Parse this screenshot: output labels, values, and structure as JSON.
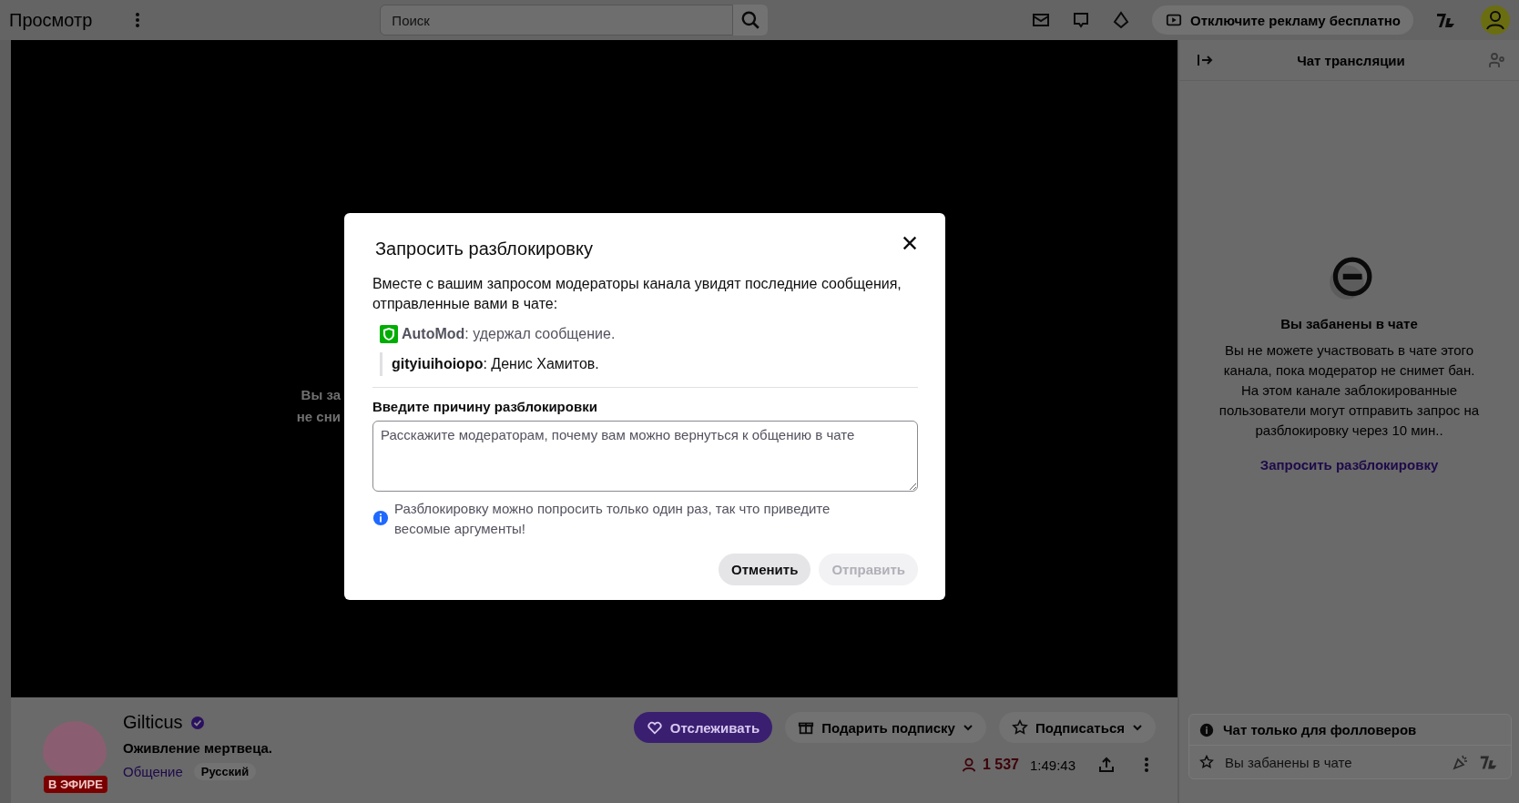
{
  "top_bar": {
    "title": "Просмотр",
    "search": {
      "placeholder": "Поиск"
    },
    "ad_button": "Отключите рекламу бесплатно"
  },
  "video": {
    "lines": [
      "Вы за",
      "не сни"
    ]
  },
  "channel": {
    "name": "Gilticus",
    "verified": true,
    "live_badge": "В ЭФИРЕ",
    "stream_title": "Оживление мертвеца.",
    "category": "Общение",
    "tags": [
      "Русский"
    ],
    "buttons": [
      {
        "label": "Отслеживать",
        "kind": "follow"
      },
      {
        "label": "Подарить подписку",
        "kind": "gift"
      },
      {
        "label": "Подписаться",
        "kind": "subscribe"
      }
    ],
    "viewers": "1 537",
    "uptime": "1:49:43"
  },
  "chat": {
    "title": "Чат трансляции",
    "banned_title": "Вы забанены в чате",
    "banned_text": "Вы не можете участвовать в чате этого канала, пока модератор не снимет бан. На этом канале заблокированные пользователи могут отправить запрос на разблокировку через 10 мин..",
    "request_link": "Запросить разблокировку",
    "notice": "Чат только для фолловеров",
    "input_placeholder": "Вы забанены в чате"
  },
  "dialog": {
    "title": "Запросить разблокировку",
    "intro": "Вместе с вашим запросом модераторы канала увидят последние сообщения, отправленные вами в чате:",
    "messages": [
      {
        "kind": "automod",
        "text": "**AutoMod**: удержал сообщение."
      },
      {
        "kind": "quoted",
        "text": "**gityiuihoiopo**: Денис Хамитов."
      }
    ],
    "reason_label": "Введите причину разблокировки",
    "reason_placeholder": "Расскажите модераторам, почему вам можно вернуться к общению в чате",
    "hint": "Разблокировку можно попросить только один раз, так что приведите весомые аргументы!",
    "buttons": [
      {
        "label": "Отменить",
        "disabled": false
      },
      {
        "label": "Отправить",
        "disabled": true
      }
    ]
  }
}
